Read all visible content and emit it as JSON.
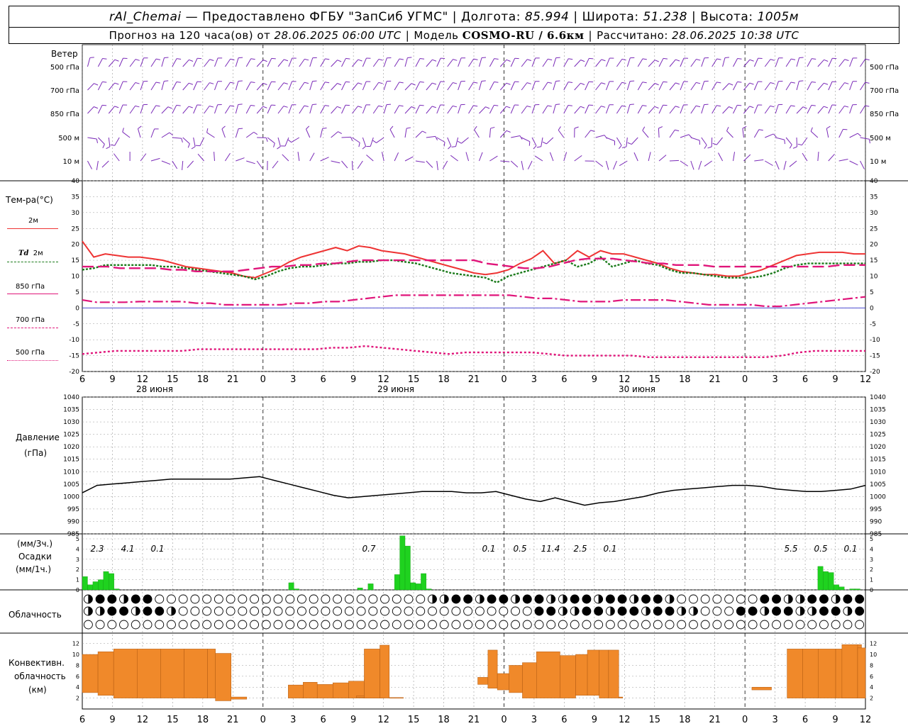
{
  "header": {
    "station": "rAl_Chemai",
    "provider": "Предоставлено ФГБУ \"ЗапСиб УГМС\"",
    "lon_label": "Долгота:",
    "lon_value": "85.994",
    "lat_label": "Широта:",
    "lat_value": "51.238",
    "alt_label": "Высота:",
    "alt_value": "1005м",
    "forecast_text": "Прогноз на 120 часа(ов) от",
    "forecast_time": "28.06.2025 06:00 UTC",
    "model_label": "Модель",
    "model_name": "COSMO-RU / 6.6км",
    "calc_label": "Рассчитано:",
    "calc_time": "28.06.2025 10:38 UTC"
  },
  "labels": {
    "wind": "Ветер",
    "wind_levels": [
      "500 гПа",
      "700 гПа",
      "850 гПа",
      "500 м",
      "10   м"
    ],
    "temp": "Тем-ра(°C)",
    "leg_2m": "2м",
    "leg_td": "Td",
    "leg_td2": "2м",
    "leg_850": "850 гПа",
    "leg_700": "700 гПа",
    "leg_500": "500 гПа",
    "pressure": "Давление",
    "pressure_unit": "(гПа)",
    "precip_unit1": "(мм/3ч.)",
    "precip": "Осадки",
    "precip_unit2": "(мм/1ч.)",
    "cloud": "Облачность",
    "conv1": "Конвективн.",
    "conv2": "облачность",
    "conv3": "(км)"
  },
  "colors": {
    "t2m": "#ee3333",
    "td2m": "#1a7a1a",
    "t850": "#e0157a",
    "t700": "#e0157a",
    "t500": "#e0157a",
    "wind": "#7a2ab8",
    "precip": "#1fd21f",
    "conv": "#f0892a",
    "pressure": "#000000",
    "zero_line": "#3333cc"
  },
  "chart_data": [
    {
      "type": "line",
      "title": "Тем-ра(°C)",
      "x_ticks": [
        "6",
        "9",
        "12",
        "15",
        "18",
        "21",
        "0",
        "3",
        "6",
        "9",
        "12",
        "15",
        "18",
        "21",
        "0",
        "3",
        "6",
        "9",
        "12",
        "15",
        "18",
        "21",
        "0",
        "3",
        "6",
        "9",
        "12"
      ],
      "date_labels": [
        "28 июня",
        "29 июня",
        "30 июня"
      ],
      "ylim": [
        -20,
        40
      ],
      "y_ticks": [
        40,
        35,
        30,
        25,
        20,
        15,
        10,
        5,
        0,
        -5,
        -10,
        -15,
        -20
      ],
      "series": [
        {
          "name": "2м",
          "values": [
            21,
            16,
            17,
            16.5,
            16,
            16,
            15.5,
            15,
            14,
            13,
            12.5,
            12,
            11.5,
            11,
            10,
            9.5,
            11,
            12.5,
            14.5,
            16,
            17,
            18,
            19,
            18,
            19.5,
            19,
            18,
            17.5,
            17,
            16,
            15,
            14,
            13,
            12,
            11,
            10.5,
            11,
            12,
            14,
            15.5,
            18,
            14,
            15,
            18,
            16,
            18,
            17,
            17,
            16,
            15,
            14,
            12.5,
            11.5,
            11,
            10.5,
            10.5,
            10,
            10,
            11,
            12,
            13.5,
            15,
            16.5,
            17,
            17.5,
            17.5,
            17.5,
            17,
            17
          ]
        },
        {
          "name": "Td 2м",
          "values": [
            12,
            12.5,
            13.5,
            13.5,
            13.5,
            13.5,
            13.5,
            13,
            13,
            12.5,
            12,
            11.5,
            11,
            10.5,
            10,
            9,
            10,
            11.5,
            12.5,
            13,
            13,
            13.5,
            14,
            14,
            14.5,
            14.5,
            15,
            15,
            14.5,
            14,
            13,
            12,
            11,
            10.5,
            10,
            9.5,
            8,
            10,
            11,
            12,
            13,
            14,
            15,
            13,
            14,
            16,
            13,
            14,
            15,
            14,
            13.5,
            12,
            11,
            11,
            10.5,
            10,
            9.5,
            9.5,
            9.5,
            10,
            11,
            12.5,
            13.5,
            14,
            14,
            14,
            14,
            14,
            14
          ]
        },
        {
          "name": "850 гПа",
          "values": [
            13,
            13,
            13,
            12.5,
            12.5,
            12.5,
            12.5,
            12,
            12,
            11.5,
            11.5,
            11.5,
            11.5,
            12,
            12.5,
            13,
            13,
            13.5,
            13.5,
            14,
            14,
            14.5,
            15,
            15,
            15,
            15,
            15,
            15,
            15,
            15,
            15,
            15,
            14,
            13.5,
            13,
            12.5,
            12.5,
            13,
            14,
            15,
            15.5,
            15.5,
            15.5,
            15,
            14.5,
            14,
            14,
            13.5,
            13.5,
            13.5,
            13,
            13,
            13,
            13,
            13,
            13,
            13,
            13,
            13,
            13,
            13.5,
            13.5,
            13.5
          ]
        },
        {
          "name": "700 гПа",
          "values": [
            2.5,
            1.8,
            1.8,
            1.8,
            2,
            2,
            2,
            2,
            1.5,
            1.5,
            1,
            1,
            1,
            1,
            1,
            1.5,
            1.5,
            2,
            2,
            2.5,
            3,
            3.5,
            4,
            4,
            4,
            4,
            4,
            4,
            4,
            4,
            4,
            3.5,
            3,
            3,
            2.5,
            2,
            2,
            2,
            2.5,
            2.5,
            2.5,
            2.5,
            2,
            1.5,
            1,
            1,
            1,
            1,
            0.5,
            0.5,
            1,
            1.5,
            2,
            2.5,
            3,
            3.5
          ]
        },
        {
          "name": "500 гПа",
          "values": [
            -14.5,
            -14,
            -13.5,
            -13.5,
            -13.5,
            -13.5,
            -13.5,
            -13,
            -13,
            -13,
            -13,
            -13,
            -13,
            -13,
            -13,
            -12.5,
            -12.5,
            -12,
            -12.5,
            -13,
            -13.5,
            -14,
            -14.5,
            -14,
            -14,
            -14,
            -14,
            -14,
            -14.5,
            -15,
            -15,
            -15,
            -15,
            -15,
            -15.5,
            -15.5,
            -15.5,
            -15.5,
            -15.5,
            -15.5,
            -15.5,
            -15.5,
            -15,
            -14,
            -13.5,
            -13.5,
            -13.5,
            -13.5
          ]
        }
      ]
    },
    {
      "type": "line",
      "title": "Давление",
      "ylabel": "(гПа)",
      "ylim": [
        985,
        1040
      ],
      "y_ticks": [
        1040,
        1035,
        1030,
        1025,
        1020,
        1015,
        1010,
        1005,
        1000,
        995,
        990,
        985
      ],
      "series": [
        {
          "name": "Давление",
          "values": [
            1001.5,
            1004.5,
            1005,
            1005.5,
            1006,
            1006.5,
            1007,
            1007,
            1007,
            1007,
            1007,
            1007.5,
            1008,
            1006.5,
            1005,
            1003.5,
            1002,
            1000.5,
            999.5,
            1000,
            1000.5,
            1001,
            1001.5,
            1002,
            1002,
            1002,
            1001.5,
            1001.5,
            1002,
            1000.5,
            999,
            998,
            999.5,
            998,
            996.5,
            997.5,
            998,
            999,
            1000,
            1001.5,
            1002.5,
            1003,
            1003.5,
            1004,
            1004.5,
            1004.5,
            1004,
            1003,
            1002.5,
            1002,
            1002,
            1002.5,
            1003,
            1004.5
          ]
        }
      ]
    },
    {
      "type": "bar",
      "title": "Осадки",
      "ylabel": "(мм/1ч.)",
      "ylim": [
        0,
        5
      ],
      "y_ticks": [
        5,
        4,
        3,
        2,
        1,
        0
      ],
      "totals_3h": [
        {
          "hour": "6",
          "value": "2.3"
        },
        {
          "hour": "9",
          "value": "4.1"
        },
        {
          "hour": "12",
          "value": "0.1"
        },
        {
          "hour": "9",
          "value": "0.7"
        },
        {
          "hour": "21",
          "value": "0.1"
        },
        {
          "hour": "0",
          "value": "0.5"
        },
        {
          "hour": "3",
          "value": "11.4"
        },
        {
          "hour": "6",
          "value": "2.5"
        },
        {
          "hour": "9",
          "value": "0.1"
        },
        {
          "hour": "3",
          "value": "5.5"
        },
        {
          "hour": "6",
          "value": "0.5"
        },
        {
          "hour": "9",
          "value": "0.1"
        }
      ],
      "hourly": [
        1.3,
        0.5,
        0.8,
        1,
        1.8,
        1.6,
        0.1,
        0,
        0,
        0,
        0,
        0,
        0,
        0,
        0,
        0,
        0,
        0,
        0,
        0,
        0,
        0,
        0,
        0,
        0,
        0,
        0,
        0,
        0,
        0,
        0,
        0,
        0,
        0,
        0,
        0,
        0,
        0,
        0,
        0.7,
        0.1,
        0,
        0,
        0,
        0,
        0,
        0,
        0,
        0,
        0,
        0,
        0,
        0.2,
        0,
        0.6,
        0,
        0,
        0,
        0,
        1.5,
        5.5,
        4.3,
        0.7,
        0.6,
        1.6,
        0.1,
        0,
        0,
        0,
        0,
        0,
        0,
        0,
        0,
        0,
        0,
        0,
        0,
        0,
        0,
        0,
        0,
        0,
        0,
        0,
        0,
        0,
        0,
        0,
        0,
        0,
        0,
        0,
        0,
        0,
        0,
        0,
        0,
        0,
        0,
        0,
        0,
        0,
        0,
        0,
        0,
        0,
        0,
        0,
        0,
        0,
        0,
        0,
        0,
        0,
        0,
        0,
        0,
        0,
        0,
        0,
        0,
        0,
        0,
        0,
        0,
        0,
        0,
        0,
        0,
        0,
        0,
        0,
        0,
        0,
        0,
        0,
        0,
        0,
        2.3,
        1.8,
        1.7,
        0.5,
        0.3,
        0,
        0.1,
        0.1,
        0
      ]
    },
    {
      "type": "bar",
      "title": "Конвективн. облачность (км)",
      "ylim": [
        0,
        13
      ],
      "y_ticks": [
        12,
        10,
        8,
        6,
        4,
        2
      ],
      "bars": [
        {
          "base": 3,
          "top": 10
        },
        {
          "base": 2.5,
          "top": 10.5
        },
        {
          "base": 2,
          "top": 11
        },
        {
          "base": 2,
          "top": 11
        },
        {
          "base": 2,
          "top": 11
        },
        {
          "base": 2,
          "top": 11
        },
        {
          "base": 2,
          "top": 11
        },
        {
          "base": 1.5,
          "top": 10.2
        },
        {
          "base": 1.8,
          "top": 2.2
        },
        {
          "base": 2,
          "top": 4.4
        },
        {
          "base": 2,
          "top": 4.9
        },
        {
          "base": 2,
          "top": 4.5
        },
        {
          "base": 2,
          "top": 4.8
        },
        {
          "base": 2,
          "top": 5.1
        },
        {
          "base": 2,
          "top": 5.4
        },
        {
          "base": 2.1,
          "top": 2.4
        },
        {
          "base": 2,
          "top": 11
        },
        {
          "base": 2,
          "top": 11.7
        },
        {
          "base": 2,
          "top": 2.1
        },
        {
          "base": 4.5,
          "top": 5.8
        },
        {
          "base": 3.8,
          "top": 10.8
        },
        {
          "base": 3.5,
          "top": 6.5
        },
        {
          "base": 3,
          "top": 8
        },
        {
          "base": 2,
          "top": 8.5
        },
        {
          "base": 2,
          "top": 10.5
        },
        {
          "base": 2,
          "top": 9.8
        },
        {
          "base": 2.5,
          "top": 10
        },
        {
          "base": 2.5,
          "top": 10.8
        },
        {
          "base": 2,
          "top": 10.8
        },
        {
          "base": 2,
          "top": 10.8
        },
        {
          "base": 2,
          "top": 2.2
        },
        {
          "base": 3.5,
          "top": 4
        },
        {
          "base": 2,
          "top": 11
        },
        {
          "base": 2,
          "top": 11
        },
        {
          "base": 2,
          "top": 11
        },
        {
          "base": 2,
          "top": 11
        },
        {
          "base": 2,
          "top": 11.8
        },
        {
          "base": 2,
          "top": 11
        },
        {
          "base": 2,
          "top": 11.8
        },
        {
          "base": 2,
          "top": 11.2
        }
      ]
    }
  ]
}
